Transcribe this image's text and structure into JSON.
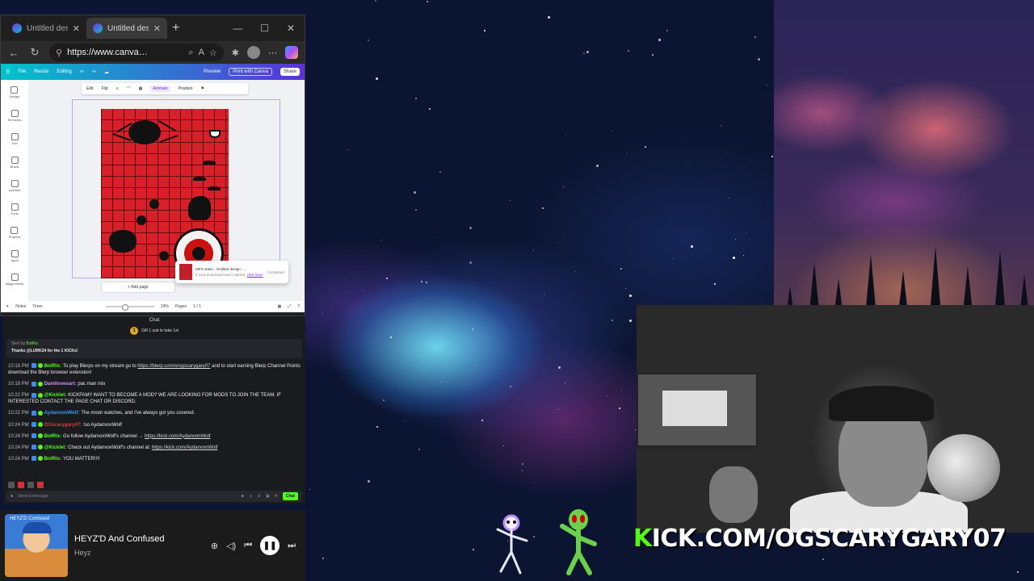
{
  "browser": {
    "tabs": [
      {
        "title": "Untitled design - …",
        "active": false
      },
      {
        "title": "Untitled design - …",
        "active": true
      }
    ],
    "url": "https://www.canva…"
  },
  "canva": {
    "topbar": {
      "file": "File",
      "resize": "Resize",
      "editing": "Editing",
      "preview": "Preview",
      "print": "Print with Canva",
      "share": "Share"
    },
    "toolbar": {
      "edit": "Edit",
      "flip": "Flip",
      "animate": "Animate",
      "position": "Position"
    },
    "sidebar": [
      "Design",
      "Elements",
      "Text",
      "Brand",
      "Uploads",
      "Tools",
      "Projects",
      "Apps",
      "Magic Media"
    ],
    "add_page": "+ Add page",
    "notification": {
      "title": "MP4 Video - Untitled design - …",
      "status": "Completed",
      "sub": "If your download hasn't started,",
      "link": "click here."
    },
    "bottom": {
      "notes": "Notes",
      "timer": "Timer",
      "zoom": "24%",
      "pages": "Pages",
      "page_count": "1 / 1"
    }
  },
  "chat": {
    "header": "Chat",
    "gift_banner": "Gift 1 sub to take 1st",
    "pinned_by": "Sent by",
    "pinned_user": "BotRix",
    "pinned_text": "Thanks @LURK24 for the 1 KICKs!",
    "messages": [
      {
        "time": "10:16 PM",
        "user": "BotRix:",
        "color": "#53fc18",
        "text": "To play Blerps on my stream go to ",
        "link": "https://blerp.com/x/ogscarygary07",
        "text2": " and to start earning Blerp Channel Points download the Blerp browser extension!"
      },
      {
        "time": "10:18 PM",
        "user": "Damilovesart:",
        "color": "#d58cff",
        "text": "pac man mix",
        "link": "",
        "text2": ""
      },
      {
        "time": "10:22 PM",
        "user": "@Kicklet:",
        "color": "#53fc18",
        "text": "KICKFAM!! WANT TO BECOME A MOD? WE ARE LOOKING FOR MODS TO JOIN THE TEAM. IF INTERESTED CONTACT THE PAGE CHAT OR DISCORD.",
        "link": "",
        "text2": ""
      },
      {
        "time": "10:22 PM",
        "user": "AydanvonWolf:",
        "color": "#3c9cf0",
        "text": "The moon watches, and I've always got you covered.",
        "link": "",
        "text2": ""
      },
      {
        "time": "10:24 PM",
        "user": "OGscarygary07:",
        "color": "#e03a3a",
        "text": "!so AydanvonWolf",
        "link": "",
        "text2": ""
      },
      {
        "time": "10:24 PM",
        "user": "BotRix:",
        "color": "#53fc18",
        "text": "Go follow AydanvonWolf's channel → ",
        "link": "https://kick.com/AydanvonWolf",
        "text2": ""
      },
      {
        "time": "10:24 PM",
        "user": "@Kicklet:",
        "color": "#53fc18",
        "text": "Check out AydanvonWolf's channel at: ",
        "link": "https://kick.com/AydanvonWolf",
        "text2": ""
      },
      {
        "time": "10:24 PM",
        "user": "BotRix:",
        "color": "#53fc18",
        "text": "YOU MATTER!!!!",
        "link": "",
        "text2": ""
      }
    ],
    "input_placeholder": "Send a message",
    "send_label": "Chat"
  },
  "player": {
    "album_text": "HEYZ'D Confused",
    "title": "HEYZ'D And Confused",
    "artist": "Heyz"
  },
  "overlay": {
    "kick_prefix": "K",
    "kick_rest": "ICK.COM/OGSCARYGARY07"
  },
  "colors": {
    "kick_green": "#53fc18",
    "canva_purple": "#7d2ae8",
    "canva_teal": "#00c4cc"
  }
}
